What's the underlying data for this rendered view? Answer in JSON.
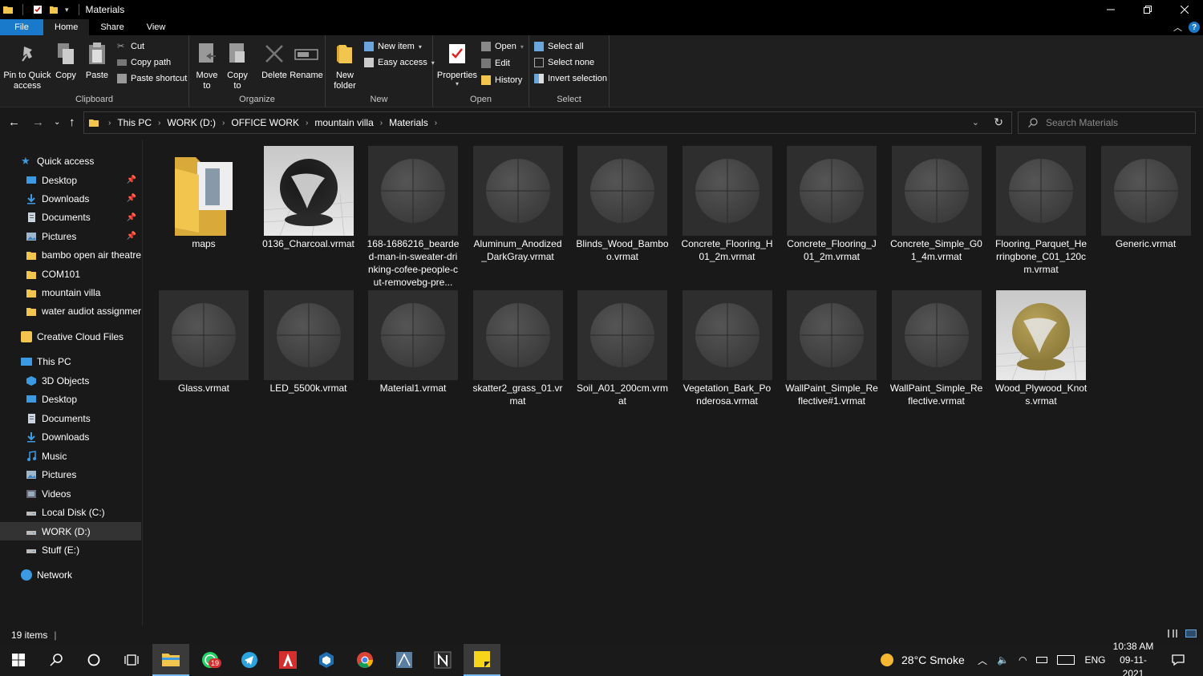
{
  "window": {
    "title": "Materials",
    "controls": [
      "minimize",
      "restore",
      "close"
    ]
  },
  "ribbon_tabs": [
    {
      "label": "File"
    },
    {
      "label": "Home"
    },
    {
      "label": "Share"
    },
    {
      "label": "View"
    }
  ],
  "ribbon": {
    "clipboard": {
      "label": "Clipboard",
      "pin": "Pin to Quick access",
      "copy": "Copy",
      "paste": "Paste",
      "cut": "Cut",
      "copy_path": "Copy path",
      "paste_shortcut": "Paste shortcut"
    },
    "organize": {
      "label": "Organize",
      "move_to": "Move to",
      "copy_to": "Copy to",
      "delete": "Delete",
      "rename": "Rename"
    },
    "new": {
      "label": "New",
      "new_folder": "New folder",
      "new_item": "New item",
      "easy_access": "Easy access"
    },
    "open": {
      "label": "Open",
      "properties": "Properties",
      "open": "Open",
      "edit": "Edit",
      "history": "History"
    },
    "select": {
      "label": "Select",
      "select_all": "Select all",
      "select_none": "Select none",
      "invert_selection": "Invert selection"
    }
  },
  "breadcrumb": [
    "This PC",
    "WORK (D:)",
    "OFFICE WORK",
    "mountain villa",
    "Materials"
  ],
  "search": {
    "placeholder": "Search Materials"
  },
  "sidebar": {
    "quick_access": "Quick access",
    "quick_items": [
      {
        "label": "Desktop",
        "icon": "desktop-icon",
        "pinned": true
      },
      {
        "label": "Downloads",
        "icon": "downloads-icon",
        "pinned": true
      },
      {
        "label": "Documents",
        "icon": "documents-icon",
        "pinned": true
      },
      {
        "label": "Pictures",
        "icon": "pictures-icon",
        "pinned": true
      },
      {
        "label": "bambo open air theatre",
        "icon": "folder-icon",
        "pinned": false
      },
      {
        "label": "COM101",
        "icon": "folder-icon",
        "pinned": false
      },
      {
        "label": "mountain villa",
        "icon": "folder-icon",
        "pinned": false
      },
      {
        "label": "water audiot assignment",
        "icon": "folder-icon",
        "pinned": false
      }
    ],
    "creative_cloud": "Creative Cloud Files",
    "this_pc": "This PC",
    "pc_items": [
      {
        "label": "3D Objects",
        "icon": "3d-objects-icon"
      },
      {
        "label": "Desktop",
        "icon": "desktop-icon"
      },
      {
        "label": "Documents",
        "icon": "documents-icon"
      },
      {
        "label": "Downloads",
        "icon": "downloads-icon"
      },
      {
        "label": "Music",
        "icon": "music-icon"
      },
      {
        "label": "Pictures",
        "icon": "pictures-icon"
      },
      {
        "label": "Videos",
        "icon": "videos-icon"
      },
      {
        "label": "Local Disk (C:)",
        "icon": "drive-icon"
      },
      {
        "label": "WORK (D:)",
        "icon": "drive-icon",
        "selected": true
      },
      {
        "label": "Stuff (E:)",
        "icon": "drive-icon"
      }
    ],
    "network": "Network"
  },
  "files": [
    {
      "name": "maps",
      "type": "folder"
    },
    {
      "name": "0136_Charcoal.vrmat",
      "type": "charcoal"
    },
    {
      "name": "168-1686216_bearded-man-in-sweater-drinking-cofee-people-cut-removebg-pre...",
      "type": "default"
    },
    {
      "name": "Aluminum_Anodized_DarkGray.vrmat",
      "type": "default"
    },
    {
      "name": "Blinds_Wood_Bamboo.vrmat",
      "type": "default"
    },
    {
      "name": "Concrete_Flooring_H01_2m.vrmat",
      "type": "default"
    },
    {
      "name": "Concrete_Flooring_J01_2m.vrmat",
      "type": "default"
    },
    {
      "name": "Concrete_Simple_G01_4m.vrmat",
      "type": "default"
    },
    {
      "name": "Flooring_Parquet_Herringbone_C01_120cm.vrmat",
      "type": "default"
    },
    {
      "name": "Generic.vrmat",
      "type": "default"
    },
    {
      "name": "Glass.vrmat",
      "type": "default"
    },
    {
      "name": "LED_5500k.vrmat",
      "type": "default"
    },
    {
      "name": "Material1.vrmat",
      "type": "default"
    },
    {
      "name": "skatter2_grass_01.vrmat",
      "type": "default"
    },
    {
      "name": "Soil_A01_200cm.vrmat",
      "type": "default"
    },
    {
      "name": "Vegetation_Bark_Ponderosa.vrmat",
      "type": "default"
    },
    {
      "name": "WallPaint_Simple_Reflective#1.vrmat",
      "type": "default"
    },
    {
      "name": "WallPaint_Simple_Reflective.vrmat",
      "type": "default"
    },
    {
      "name": "Wood_Plywood_Knots.vrmat",
      "type": "wood"
    }
  ],
  "status": {
    "item_count": "19 items"
  },
  "taskbar": {
    "apps": [
      "windows-start-icon",
      "search-icon",
      "cortana-icon",
      "task-view-icon",
      "file-explorer-icon",
      "whatsapp-icon",
      "telegram-icon",
      "autocad-icon",
      "sketchup-icon",
      "chrome-icon",
      "app-icon",
      "notion-icon",
      "sticky-notes-icon"
    ],
    "whatsapp_badge": "19",
    "weather": "28°C  Smoke",
    "language": "ENG",
    "time": "10:38 AM",
    "date": "09-11-2021"
  },
  "colors": {
    "accent": "#1979ca",
    "folder": "#f2c54e",
    "background": "#191919"
  }
}
